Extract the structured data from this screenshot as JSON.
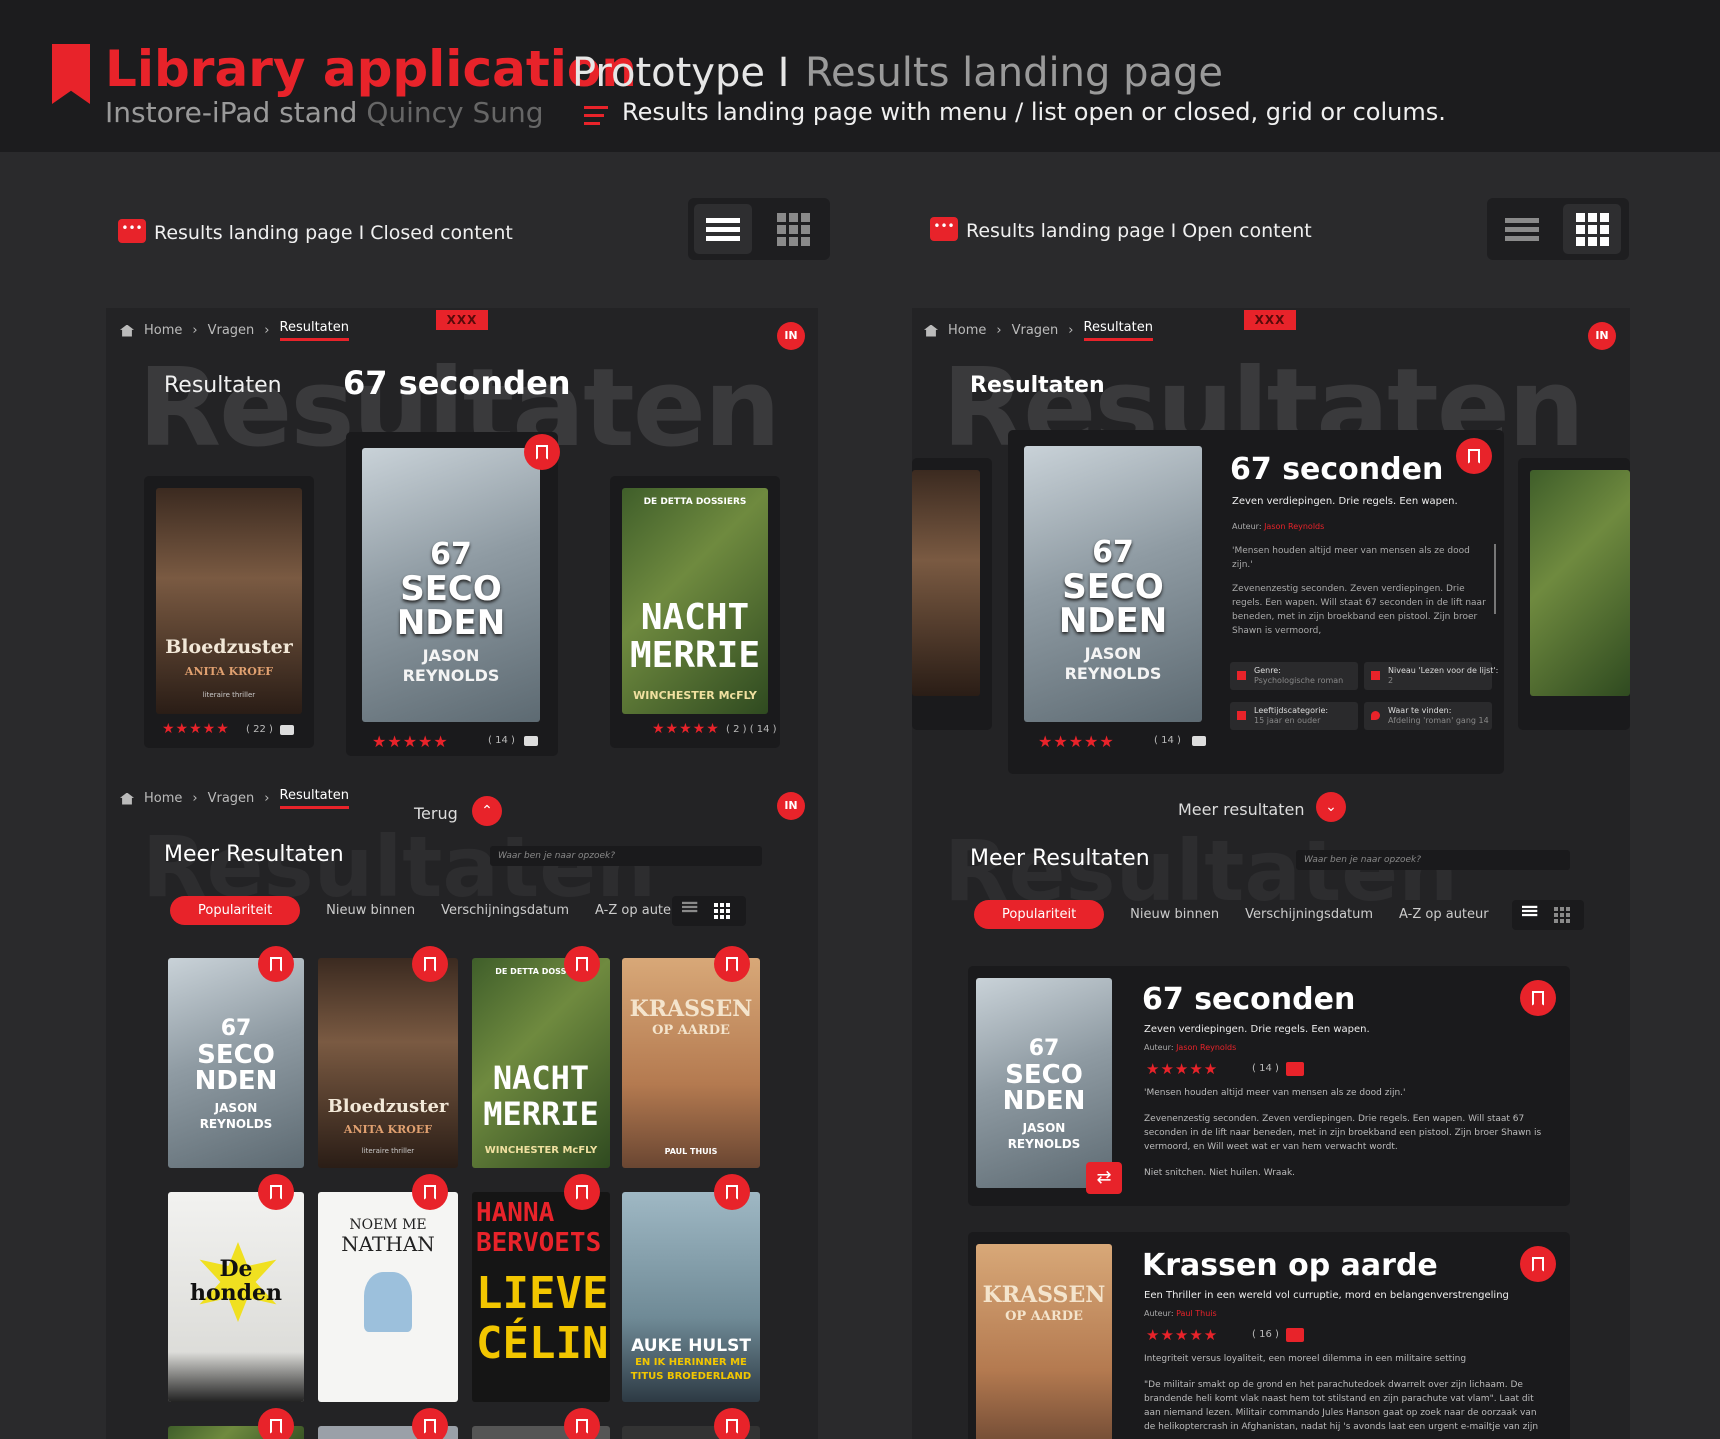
{
  "header": {
    "title": "Library application",
    "proto": "Prototype I",
    "landing": "Results landing page",
    "sub_a": "Instore-iPad stand",
    "sub_b": "Quincy Sung",
    "desc": "Results landing page with menu / list open or closed, grid or colums."
  },
  "left": {
    "section": "Results landing page I Closed content",
    "crumb": [
      "Home",
      "Vragen",
      "Resultaten"
    ],
    "xxx": "XXX",
    "logo": "IN",
    "results_label": "Resultaten",
    "watermark": "Resultaten",
    "featured_title": "67 seconden",
    "carousel": [
      {
        "stars": "★★★★★",
        "count": "( 22 )"
      },
      {
        "stars": "★★★★★",
        "count": "( 14 )"
      },
      {
        "stars": "★★★★★",
        "count": "( 2 )   ( 14 )"
      }
    ],
    "more": {
      "back": "Terug",
      "title": "Meer Resultaten",
      "search_ph": "Waar ben je naar opzoek?",
      "tabs": [
        "Populariteit",
        "Nieuw binnen",
        "Verschijningsdatum",
        "A-Z op auteur"
      ]
    }
  },
  "right": {
    "section": "Results landing page I Open content",
    "crumb": [
      "Home",
      "Vragen",
      "Resultaten"
    ],
    "xxx": "XXX",
    "logo": "IN",
    "results_label": "Resultaten",
    "watermark": "Resultaten",
    "detail": {
      "title": "67 seconden",
      "tagline": "Zeven verdiepingen. Drie regels. Een wapen.",
      "auteur_label": "Auteur:",
      "auteur": "Jason Reynolds",
      "quote": "'Mensen houden altijd meer van mensen als ze dood zijn.'",
      "body": "Zevenenzestig seconden. Zeven verdiepingen. Drie regels. Een wapen. Will staat 67 seconden in de lift naar beneden, met in zijn broekband een pistool. Zijn broer Shawn is vermoord,",
      "genre_l": "Genre:",
      "genre": "Psychologische roman",
      "niveau_l": "Niveau 'Lezen voor de lijst':",
      "niveau": "2",
      "leeftijd_l": "Leeftijdscategorie:",
      "leeftijd": "15 jaar en ouder",
      "waar_l": "Waar te vinden:",
      "waar": "Afdeling 'roman' gang 14",
      "stars": "★★★★★",
      "count": "( 14 )"
    },
    "more_btn": "Meer resultaten",
    "more_title": "Meer Resultaten",
    "search_ph": "Waar ben je naar opzoek?",
    "tabs": [
      "Populariteit",
      "Nieuw binnen",
      "Verschijningsdatum",
      "A-Z op auteur"
    ],
    "list": [
      {
        "title": "67 seconden",
        "tagline": "Zeven verdiepingen. Drie regels. Een wapen.",
        "auteur_label": "Auteur:",
        "auteur": "Jason Reynolds",
        "stars": "★★★★★",
        "count": "( 14 )",
        "p1": "'Mensen houden altijd meer van mensen als ze dood zijn.'",
        "p2": "Zevenenzestig seconden. Zeven verdiepingen. Drie regels. Een wapen. Will staat 67 seconden in de lift naar beneden, met in zijn broekband een pistool. Zijn broer Shawn is vermoord, en Will weet wat er van hem verwacht wordt.",
        "p3": "Niet snitchen. Niet huilen. Wraak."
      },
      {
        "title": "Krassen op aarde",
        "tagline": "Een Thriller in een wereld vol curruptie, mord en belangenverstrengeling",
        "auteur_label": "Auteur:",
        "auteur": "Paul Thuis",
        "stars": "★★★★★",
        "count": "( 16 )",
        "p1": "Integriteit versus loyaliteit, een moreel dilemma in een militaire setting",
        "p2": "\"De militair smakt op de grond en het parachutedoek dwarrelt over zijn lichaam. De brandende heli komt vlak naast hem tot stilstand en zijn parachute vat vlam\". Laat dit aan niemand lezen. Militair commando Jules Hanson gaat op zoek naar de oorzaak van de helikoptercrash in Afghanistan, nadat hij 's avonds laat een urgent e-mailtje van zijn"
      }
    ]
  },
  "covers": {
    "sec": [
      "67",
      "SECO",
      "NDEN",
      "JASON",
      "REYNOLDS"
    ],
    "blood": [
      "Bloedzuster",
      "ANITA KROEF",
      "literaire thriller"
    ],
    "nacht": [
      "DE DETTA DOSSIERS",
      "NACHT",
      "MERRIE",
      "WINCHESTER McFLY"
    ],
    "kras": [
      "KRASSEN",
      "OP AARDE",
      "PAUL THUIS"
    ],
    "hond": [
      "De",
      "honden"
    ],
    "noem": [
      "NOEM ME",
      "NATHAN"
    ],
    "hanna": [
      "HANNA",
      "BERVOETS",
      "LIEVE",
      "CÉLINE"
    ],
    "auke": [
      "AUKE HULST",
      "EN IK HERINNER ME",
      "TITUS BROEDERLAND"
    ]
  }
}
